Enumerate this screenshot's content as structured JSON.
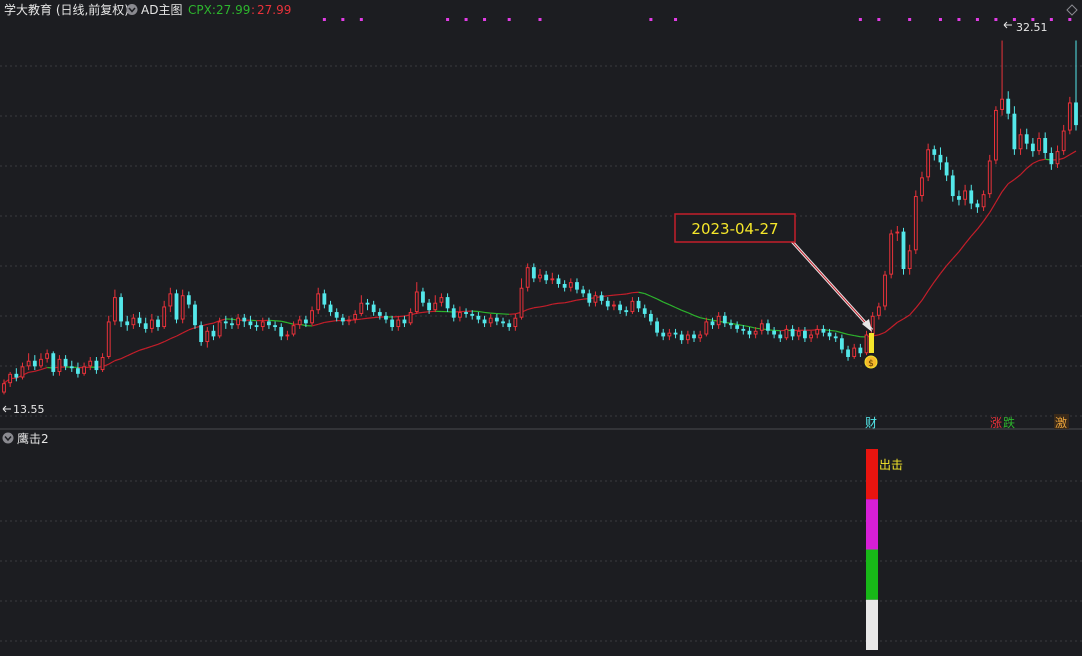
{
  "header": {
    "stock_title": "学大教育 (日线,前复权)",
    "main_indicator": "AD主图",
    "cpx_label": "CPX: ",
    "cpx_value_1": "27.99",
    "cpx_value_2": "27.99"
  },
  "annotations": {
    "date_callout": "2023-04-27",
    "high_label": "32.51",
    "low_label": "13.55",
    "signal_label": "出击",
    "event_cai": "财",
    "event_zhang": "涨",
    "event_die": "跌",
    "event_ji": "激",
    "circle_marker": "$"
  },
  "sub_panel": {
    "title": "鹰击2"
  },
  "colors": {
    "background": "#1c1d21",
    "up_candle": "#e8323a",
    "down_candle": "#54e8ea",
    "ma_up": "#c41e2a",
    "ma_down": "#2db52d",
    "magenta_marker": "#e23ce6",
    "signal_yellow": "#f5e62a",
    "grid": "#3a3a3f"
  },
  "chart_data": {
    "type": "candlestick",
    "y_range_main": [
      12.5,
      33.5
    ],
    "high": 32.51,
    "low": 13.55,
    "callout_date": "2023-04-27",
    "signal_bar_segments": [
      {
        "color": "red",
        "fraction": 0.25
      },
      {
        "color": "magenta",
        "fraction": 0.25
      },
      {
        "color": "green",
        "fraction": 0.25
      },
      {
        "color": "white",
        "fraction": 0.25
      }
    ],
    "candles": [
      [
        13.7,
        14.2,
        14.4,
        13.6
      ],
      [
        14.2,
        14.7,
        14.8,
        14.0
      ],
      [
        14.7,
        14.5,
        15.0,
        14.3
      ],
      [
        14.5,
        15.1,
        15.3,
        14.4
      ],
      [
        15.1,
        15.4,
        15.8,
        14.9
      ],
      [
        15.4,
        15.1,
        15.7,
        14.9
      ],
      [
        15.1,
        15.5,
        15.8,
        15.0
      ],
      [
        15.5,
        15.8,
        16.0,
        15.3
      ],
      [
        15.8,
        14.8,
        15.9,
        14.6
      ],
      [
        14.8,
        15.5,
        15.7,
        14.6
      ],
      [
        15.5,
        15.1,
        15.7,
        14.9
      ],
      [
        15.1,
        15.0,
        15.4,
        14.8
      ],
      [
        15.0,
        14.7,
        15.3,
        14.5
      ],
      [
        14.7,
        15.1,
        15.3,
        14.6
      ],
      [
        15.1,
        15.4,
        15.6,
        14.9
      ],
      [
        15.4,
        14.9,
        15.6,
        14.7
      ],
      [
        14.9,
        15.6,
        15.8,
        14.8
      ],
      [
        15.6,
        17.5,
        17.8,
        15.5
      ],
      [
        17.5,
        18.8,
        19.2,
        17.3
      ],
      [
        18.8,
        17.5,
        19.0,
        17.2
      ],
      [
        17.5,
        17.3,
        17.8,
        17.0
      ],
      [
        17.3,
        17.7,
        17.9,
        17.1
      ],
      [
        17.7,
        17.4,
        18.0,
        17.2
      ],
      [
        17.4,
        17.1,
        17.7,
        16.9
      ],
      [
        17.1,
        17.6,
        17.9,
        16.9
      ],
      [
        17.6,
        17.2,
        17.8,
        17.0
      ],
      [
        17.2,
        18.3,
        18.6,
        17.1
      ],
      [
        18.3,
        19.0,
        19.3,
        18.0
      ],
      [
        19.0,
        17.6,
        19.2,
        17.4
      ],
      [
        17.6,
        18.9,
        19.2,
        17.4
      ],
      [
        18.9,
        18.4,
        19.1,
        18.2
      ],
      [
        18.4,
        17.3,
        18.6,
        17.1
      ],
      [
        17.3,
        16.4,
        17.5,
        16.2
      ],
      [
        16.4,
        17.0,
        17.2,
        16.1
      ],
      [
        17.0,
        16.7,
        17.3,
        16.5
      ],
      [
        16.7,
        17.5,
        17.7,
        16.6
      ],
      [
        17.5,
        17.4,
        17.8,
        17.1
      ],
      [
        17.4,
        17.3,
        17.7,
        17.1
      ],
      [
        17.3,
        17.7,
        17.9,
        17.1
      ],
      [
        17.7,
        17.5,
        17.9,
        17.2
      ],
      [
        17.5,
        17.3,
        17.8,
        17.1
      ],
      [
        17.3,
        17.2,
        17.5,
        17.0
      ],
      [
        17.2,
        17.5,
        17.7,
        17.0
      ],
      [
        17.5,
        17.3,
        17.7,
        17.1
      ],
      [
        17.3,
        17.2,
        17.5,
        17.0
      ],
      [
        17.2,
        16.7,
        17.4,
        16.5
      ],
      [
        16.7,
        16.8,
        17.0,
        16.5
      ],
      [
        16.8,
        17.3,
        17.5,
        16.7
      ],
      [
        17.3,
        17.6,
        17.8,
        17.1
      ],
      [
        17.6,
        17.4,
        17.8,
        17.2
      ],
      [
        17.4,
        18.1,
        18.3,
        17.3
      ],
      [
        18.1,
        19.0,
        19.3,
        17.9
      ],
      [
        19.0,
        18.4,
        19.2,
        18.2
      ],
      [
        18.4,
        18.0,
        18.6,
        17.8
      ],
      [
        18.0,
        17.7,
        18.2,
        17.5
      ],
      [
        17.7,
        17.5,
        17.9,
        17.3
      ],
      [
        17.5,
        17.6,
        17.8,
        17.3
      ],
      [
        17.6,
        17.9,
        18.1,
        17.4
      ],
      [
        17.9,
        18.5,
        18.9,
        17.8
      ],
      [
        18.5,
        18.4,
        18.7,
        18.1
      ],
      [
        18.4,
        18.0,
        18.6,
        17.8
      ],
      [
        18.0,
        17.8,
        18.2,
        17.6
      ],
      [
        17.8,
        17.6,
        18.0,
        17.4
      ],
      [
        17.6,
        17.2,
        17.8,
        17.0
      ],
      [
        17.2,
        17.6,
        17.8,
        17.0
      ],
      [
        17.6,
        17.4,
        17.8,
        17.2
      ],
      [
        17.4,
        18.0,
        18.2,
        17.3
      ],
      [
        18.0,
        19.1,
        19.6,
        17.9
      ],
      [
        19.1,
        18.5,
        19.3,
        18.3
      ],
      [
        18.5,
        18.1,
        18.7,
        17.9
      ],
      [
        18.1,
        18.5,
        18.9,
        18.0
      ],
      [
        18.5,
        18.8,
        19.0,
        18.3
      ],
      [
        18.8,
        18.2,
        19.0,
        18.0
      ],
      [
        18.2,
        17.7,
        18.4,
        17.5
      ],
      [
        17.7,
        18.0,
        18.3,
        17.5
      ],
      [
        18.0,
        17.9,
        18.2,
        17.7
      ],
      [
        17.9,
        17.8,
        18.1,
        17.6
      ],
      [
        17.8,
        17.6,
        18.0,
        17.4
      ],
      [
        17.6,
        17.4,
        17.8,
        17.2
      ],
      [
        17.4,
        17.7,
        17.9,
        17.2
      ],
      [
        17.7,
        17.5,
        17.9,
        17.3
      ],
      [
        17.5,
        17.4,
        17.7,
        17.2
      ],
      [
        17.4,
        17.2,
        17.6,
        17.0
      ],
      [
        17.2,
        17.7,
        17.9,
        17.0
      ],
      [
        17.7,
        19.3,
        19.8,
        17.6
      ],
      [
        19.3,
        20.4,
        20.6,
        19.1
      ],
      [
        20.4,
        19.8,
        20.6,
        19.6
      ],
      [
        19.8,
        20.0,
        20.3,
        19.6
      ],
      [
        20.0,
        19.7,
        20.2,
        19.5
      ],
      [
        19.7,
        19.8,
        20.1,
        19.5
      ],
      [
        19.8,
        19.5,
        20.0,
        19.3
      ],
      [
        19.5,
        19.3,
        19.7,
        19.1
      ],
      [
        19.3,
        19.6,
        19.8,
        19.1
      ],
      [
        19.6,
        19.2,
        19.8,
        19.0
      ],
      [
        19.2,
        19.0,
        19.4,
        18.8
      ],
      [
        19.0,
        18.5,
        19.2,
        18.3
      ],
      [
        18.5,
        18.9,
        19.1,
        18.3
      ],
      [
        18.9,
        18.6,
        19.1,
        18.4
      ],
      [
        18.6,
        18.3,
        18.8,
        18.1
      ],
      [
        18.3,
        18.4,
        18.6,
        18.1
      ],
      [
        18.4,
        18.1,
        18.6,
        17.9
      ],
      [
        18.1,
        18.0,
        18.3,
        17.8
      ],
      [
        18.0,
        18.6,
        18.8,
        17.9
      ],
      [
        18.6,
        18.2,
        18.8,
        18.0
      ],
      [
        18.2,
        17.9,
        18.4,
        17.7
      ],
      [
        17.9,
        17.5,
        18.1,
        17.3
      ],
      [
        17.5,
        16.9,
        17.7,
        16.7
      ],
      [
        16.9,
        16.7,
        17.1,
        16.5
      ],
      [
        16.7,
        16.9,
        17.1,
        16.5
      ],
      [
        16.9,
        16.8,
        17.1,
        16.6
      ],
      [
        16.8,
        16.5,
        17.0,
        16.3
      ],
      [
        16.5,
        16.8,
        17.0,
        16.3
      ],
      [
        16.8,
        16.6,
        17.0,
        16.4
      ],
      [
        16.6,
        16.8,
        17.0,
        16.4
      ],
      [
        16.8,
        17.5,
        17.7,
        16.7
      ],
      [
        17.5,
        17.3,
        17.7,
        17.1
      ],
      [
        17.3,
        17.8,
        18.0,
        17.1
      ],
      [
        17.8,
        17.4,
        18.0,
        17.2
      ],
      [
        17.4,
        17.3,
        17.6,
        17.1
      ],
      [
        17.3,
        17.1,
        17.5,
        16.9
      ],
      [
        17.1,
        17.0,
        17.3,
        16.8
      ],
      [
        17.0,
        16.8,
        17.2,
        16.6
      ],
      [
        16.8,
        17.0,
        17.2,
        16.6
      ],
      [
        17.0,
        17.4,
        17.6,
        16.8
      ],
      [
        17.4,
        17.0,
        17.6,
        16.8
      ],
      [
        17.0,
        16.8,
        17.2,
        16.6
      ],
      [
        16.8,
        16.6,
        17.0,
        16.4
      ],
      [
        16.6,
        17.1,
        17.3,
        16.5
      ],
      [
        17.1,
        16.7,
        17.3,
        16.5
      ],
      [
        16.7,
        17.0,
        17.2,
        16.5
      ],
      [
        17.0,
        16.6,
        17.2,
        16.4
      ],
      [
        16.6,
        16.8,
        17.0,
        16.4
      ],
      [
        16.8,
        17.1,
        17.3,
        16.6
      ],
      [
        17.1,
        16.9,
        17.3,
        16.7
      ],
      [
        16.9,
        16.7,
        17.1,
        16.5
      ],
      [
        16.7,
        16.6,
        16.9,
        16.4
      ],
      [
        16.6,
        16.0,
        16.8,
        15.8
      ],
      [
        16.0,
        15.6,
        16.2,
        15.4
      ],
      [
        15.6,
        16.1,
        16.3,
        15.5
      ],
      [
        16.1,
        15.8,
        16.3,
        15.6
      ],
      [
        15.8,
        16.8,
        17.0,
        15.7
      ],
      [
        16.8,
        17.8,
        18.0,
        16.6
      ],
      [
        17.8,
        18.3,
        18.5,
        17.6
      ],
      [
        18.3,
        20.0,
        20.2,
        18.1
      ],
      [
        20.0,
        22.2,
        22.4,
        19.8
      ],
      [
        22.2,
        22.3,
        22.6,
        21.8
      ],
      [
        22.3,
        20.3,
        22.5,
        20.0
      ],
      [
        20.3,
        21.3,
        21.6,
        20.0
      ],
      [
        21.3,
        24.2,
        24.5,
        21.1
      ],
      [
        24.2,
        25.2,
        25.5,
        23.9
      ],
      [
        25.2,
        26.7,
        27.0,
        25.0
      ],
      [
        26.7,
        26.4,
        26.9,
        26.1
      ],
      [
        26.4,
        26.0,
        26.8,
        25.6
      ],
      [
        26.0,
        25.3,
        26.3,
        25.0
      ],
      [
        25.3,
        24.2,
        25.6,
        23.9
      ],
      [
        24.2,
        24.0,
        24.5,
        23.7
      ],
      [
        24.0,
        24.5,
        24.8,
        23.7
      ],
      [
        24.5,
        23.8,
        24.8,
        23.5
      ],
      [
        23.8,
        23.6,
        24.0,
        23.3
      ],
      [
        23.6,
        24.3,
        24.5,
        23.4
      ],
      [
        24.3,
        26.1,
        26.4,
        24.1
      ],
      [
        26.1,
        28.8,
        29.0,
        25.9
      ],
      [
        28.8,
        29.4,
        32.51,
        28.5
      ],
      [
        29.4,
        28.6,
        29.8,
        28.3
      ],
      [
        28.6,
        26.7,
        29.0,
        26.4
      ],
      [
        26.7,
        27.5,
        27.8,
        26.4
      ],
      [
        27.5,
        27.0,
        27.8,
        26.7
      ],
      [
        27.0,
        26.6,
        27.3,
        26.3
      ],
      [
        26.6,
        27.3,
        27.6,
        26.4
      ],
      [
        27.3,
        26.5,
        27.6,
        26.2
      ],
      [
        26.5,
        25.9,
        26.8,
        25.6
      ],
      [
        25.9,
        26.6,
        26.9,
        25.7
      ],
      [
        26.6,
        27.7,
        28.0,
        26.4
      ],
      [
        27.7,
        29.2,
        29.5,
        27.5
      ],
      [
        29.2,
        27.99,
        32.51,
        27.7
      ]
    ]
  }
}
